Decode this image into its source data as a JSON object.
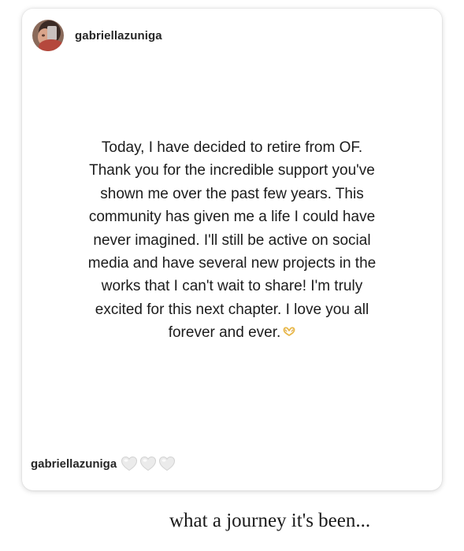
{
  "post": {
    "username": "gabriellazuniga",
    "avatar_icon": "profile-photo",
    "lines": [
      "Today, I have decided to retire from OF.",
      "Thank you for the incredible support you've",
      "shown me over the past few years. This",
      "community has given me a life I could have",
      "never imagined. I'll still be active on social",
      "media and have several new projects in the",
      "works that I can't wait to share! I'm truly",
      "excited for this next chapter. I love you all",
      "forever and ever."
    ],
    "end_emoji": "heart-hands-icon",
    "footer_username": "gabriellazuniga",
    "footer_icons": [
      "white-heart-icon",
      "white-heart-icon",
      "white-heart-icon"
    ]
  },
  "caption": "what a journey it's been...",
  "colors": {
    "text": "#1c1c1c",
    "username": "#262626",
    "emoji": "#e8b84a",
    "heart": "#e6e6e6"
  }
}
